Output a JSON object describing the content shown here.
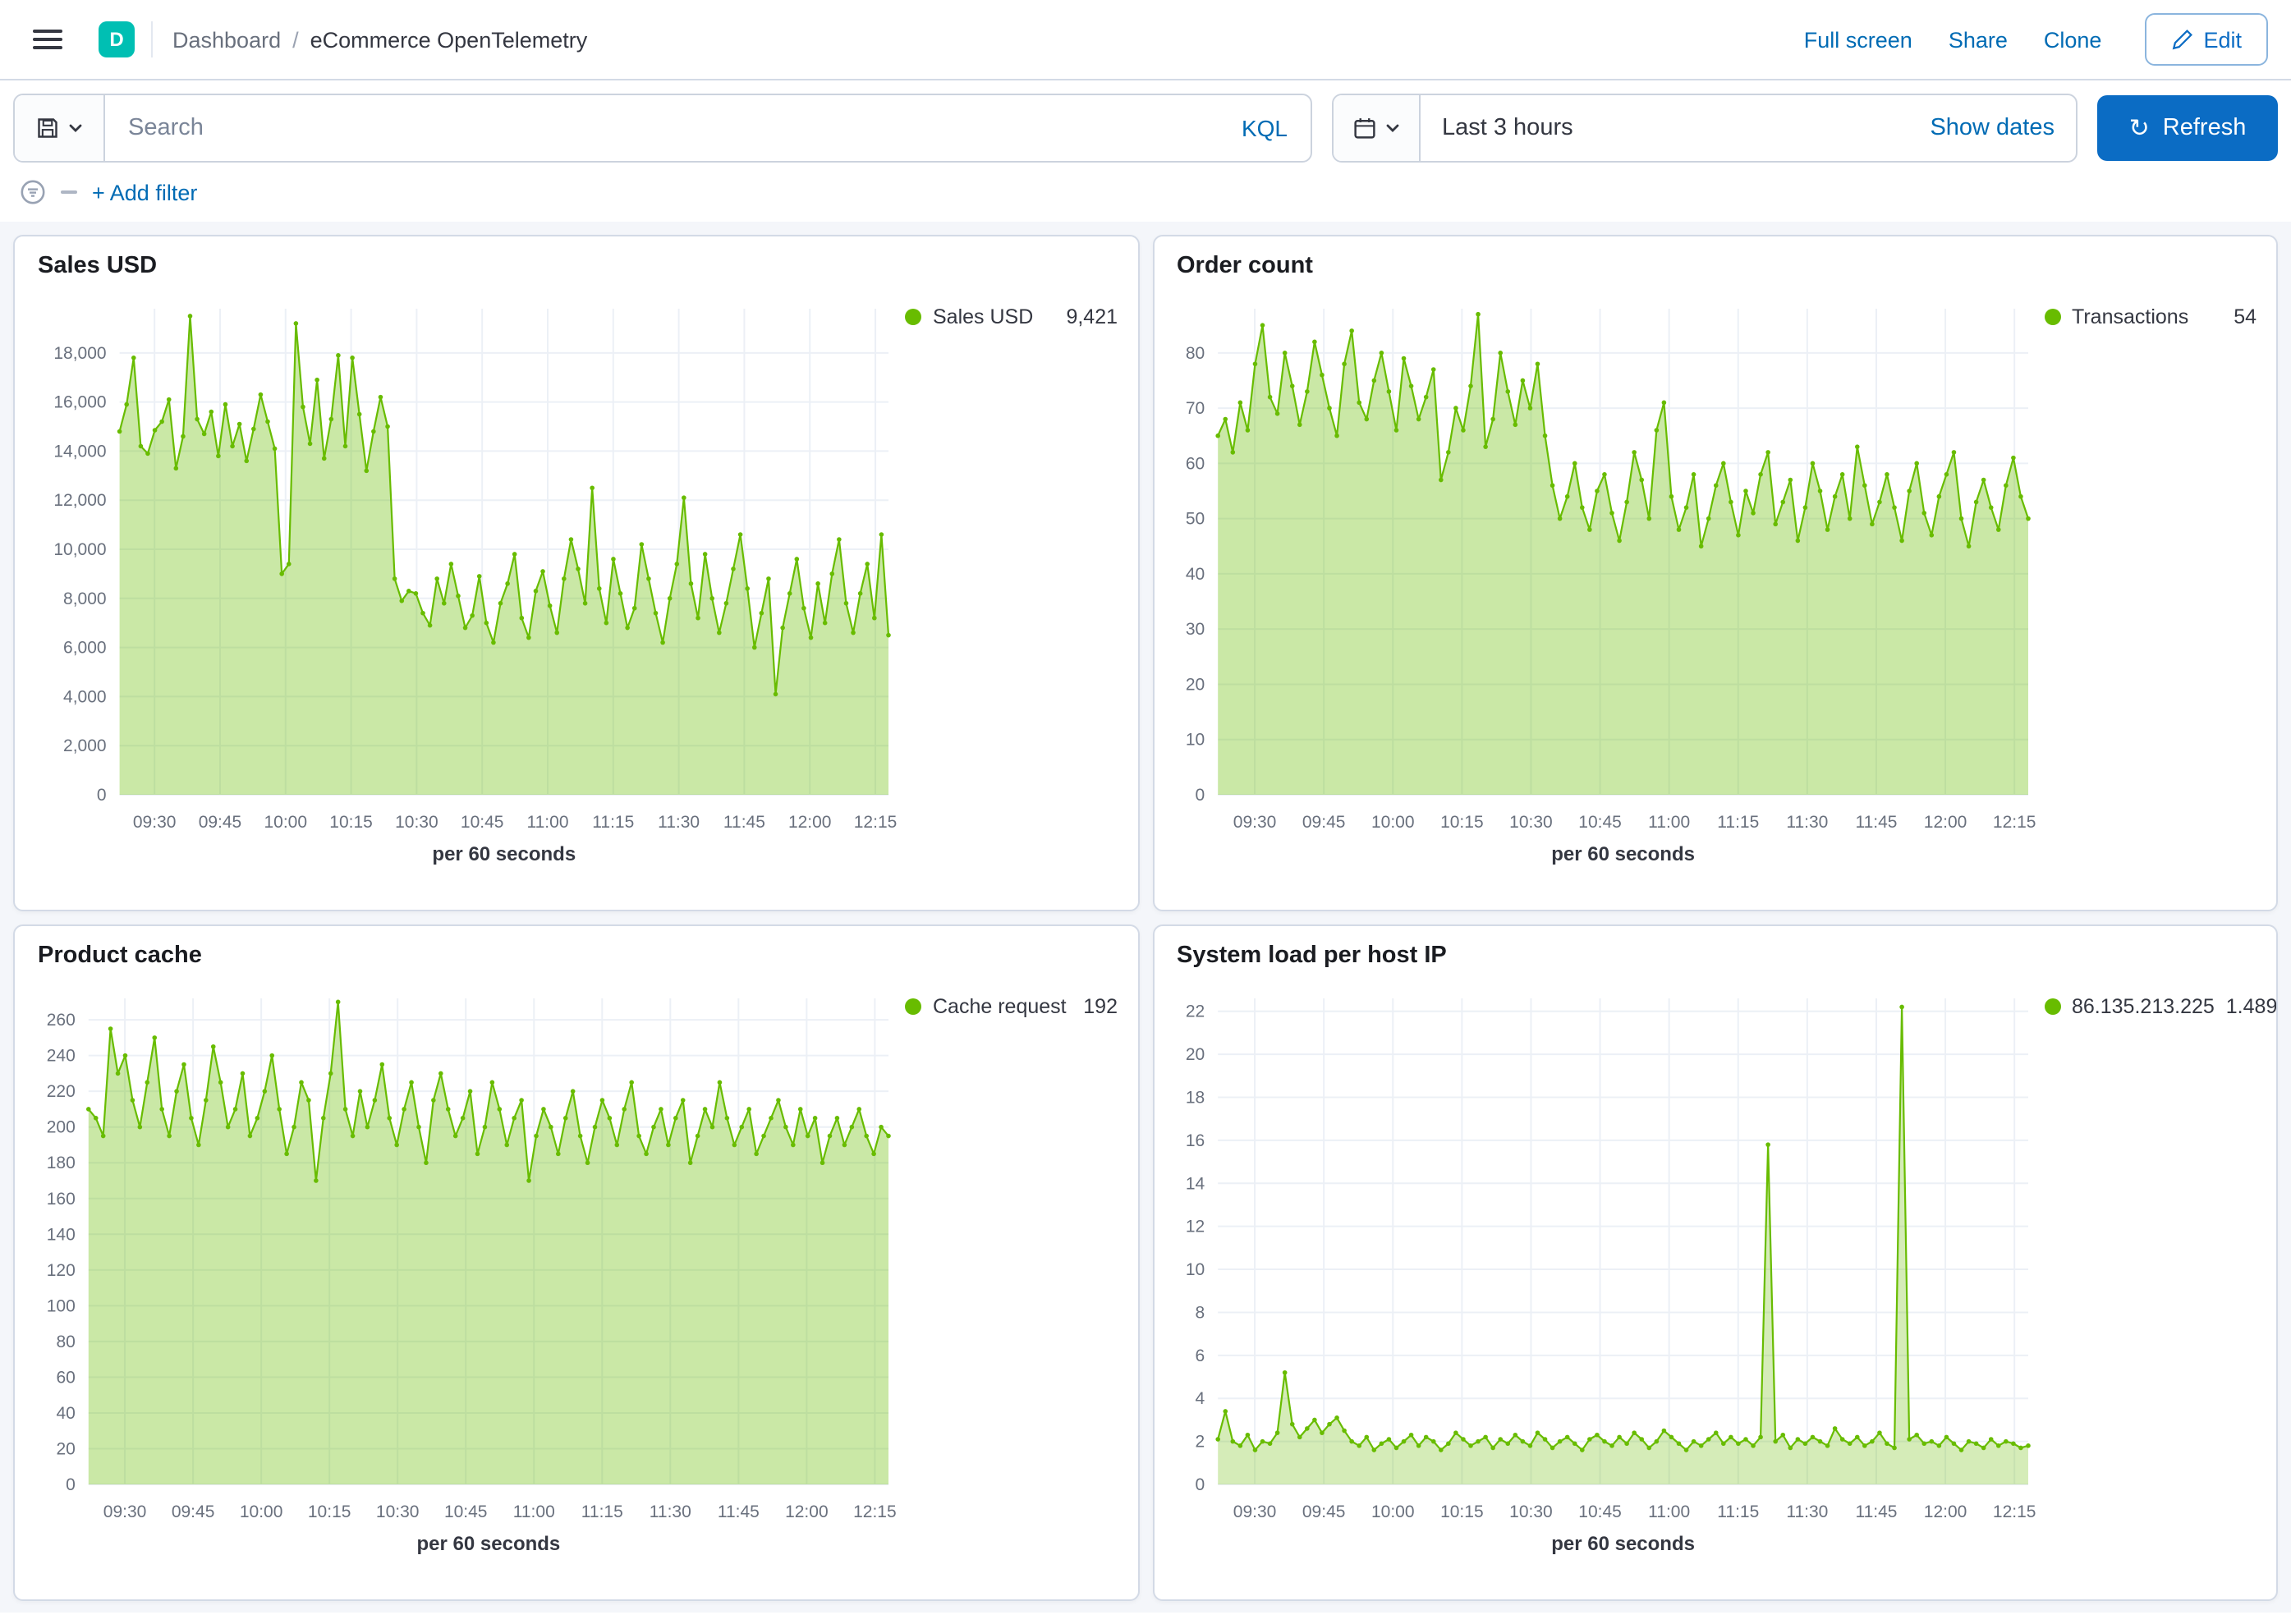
{
  "header": {
    "space_badge": "D",
    "breadcrumb": {
      "root": "Dashboard",
      "separator": "/",
      "current": "eCommerce OpenTelemetry"
    },
    "actions": [
      "Full screen",
      "Share",
      "Clone"
    ],
    "edit_label": "Edit"
  },
  "query_bar": {
    "search_placeholder": "Search",
    "kql_label": "KQL",
    "time_range": "Last 3 hours",
    "show_dates_label": "Show dates",
    "refresh_label": "Refresh"
  },
  "filter_bar": {
    "add_filter_label": "+ Add filter"
  },
  "colors": {
    "accent_green": "#68BC00",
    "grid": "#ecf0f6",
    "axis_text": "#69707d",
    "axis_title": "#343741",
    "primary_blue": "#0b6cc4",
    "link_blue": "#006bb4",
    "space_badge_teal": "#00bfb3"
  },
  "chart_data": [
    {
      "type": "area",
      "title": "Sales USD",
      "legend_label": "Sales USD",
      "legend_value": "9,421",
      "xlabel": "per 60 seconds",
      "x_domain": [
        "09:22",
        "12:18"
      ],
      "x_ticks": [
        "09:30",
        "09:45",
        "10:00",
        "10:15",
        "10:30",
        "10:45",
        "11:00",
        "11:15",
        "11:30",
        "11:45",
        "12:00",
        "12:15"
      ],
      "y_ticks": [
        0,
        2000,
        4000,
        6000,
        8000,
        10000,
        12000,
        14000,
        16000,
        18000
      ],
      "y_tick_labels": [
        "0",
        "2,000",
        "4,000",
        "6,000",
        "8,000",
        "10,000",
        "12,000",
        "14,000",
        "16,000",
        "18,000"
      ],
      "ylim": [
        0,
        19800
      ],
      "color": "#68BC00",
      "fill_opacity": 0.35,
      "values": [
        14800,
        15900,
        17800,
        14200,
        13900,
        14850,
        15200,
        16100,
        13300,
        14600,
        19500,
        15300,
        14700,
        15600,
        13800,
        15900,
        14200,
        15100,
        13600,
        14900,
        16300,
        15200,
        14100,
        9000,
        9400,
        19200,
        15800,
        14300,
        16900,
        13700,
        15300,
        17900,
        14200,
        17800,
        15500,
        13200,
        14800,
        16200,
        15000,
        8800,
        7900,
        8300,
        8200,
        7400,
        6900,
        8800,
        7800,
        9400,
        8100,
        6800,
        7300,
        8900,
        7000,
        6200,
        7800,
        8600,
        9800,
        7200,
        6400,
        8300,
        9100,
        7700,
        6600,
        8800,
        10400,
        9200,
        7800,
        12500,
        8400,
        7000,
        9600,
        8200,
        6800,
        7600,
        10200,
        8800,
        7400,
        6200,
        8000,
        9400,
        12100,
        8600,
        7200,
        9800,
        8000,
        6600,
        7800,
        9200,
        10600,
        8400,
        6000,
        7400,
        8800,
        4100,
        6800,
        8200,
        9600,
        7600,
        6400,
        8600,
        7000,
        9000,
        10400,
        7800,
        6600,
        8200,
        9400,
        7200,
        10600,
        6500
      ]
    },
    {
      "type": "area",
      "title": "Order count",
      "legend_label": "Transactions",
      "legend_value": "54",
      "xlabel": "per 60 seconds",
      "x_domain": [
        "09:22",
        "12:18"
      ],
      "x_ticks": [
        "09:30",
        "09:45",
        "10:00",
        "10:15",
        "10:30",
        "10:45",
        "11:00",
        "11:15",
        "11:30",
        "11:45",
        "12:00",
        "12:15"
      ],
      "y_ticks": [
        0,
        10,
        20,
        30,
        40,
        50,
        60,
        70,
        80
      ],
      "y_tick_labels": [
        "0",
        "10",
        "20",
        "30",
        "40",
        "50",
        "60",
        "70",
        "80"
      ],
      "ylim": [
        0,
        88
      ],
      "color": "#68BC00",
      "fill_opacity": 0.35,
      "values": [
        65,
        68,
        62,
        71,
        66,
        78,
        85,
        72,
        69,
        80,
        74,
        67,
        73,
        82,
        76,
        70,
        65,
        78,
        84,
        71,
        68,
        75,
        80,
        73,
        66,
        79,
        74,
        68,
        72,
        77,
        57,
        62,
        70,
        66,
        74,
        87,
        63,
        68,
        80,
        73,
        67,
        75,
        70,
        78,
        65,
        56,
        50,
        54,
        60,
        52,
        48,
        55,
        58,
        51,
        46,
        53,
        62,
        57,
        50,
        66,
        71,
        54,
        48,
        52,
        58,
        45,
        50,
        56,
        60,
        53,
        47,
        55,
        51,
        58,
        62,
        49,
        53,
        57,
        46,
        52,
        60,
        55,
        48,
        54,
        58,
        50,
        63,
        56,
        49,
        53,
        58,
        52,
        46,
        55,
        60,
        51,
        47,
        54,
        58,
        62,
        50,
        45,
        53,
        57,
        52,
        48,
        56,
        61,
        54,
        50
      ]
    },
    {
      "type": "area",
      "title": "Product cache",
      "legend_label": "Cache request",
      "legend_value": "192",
      "xlabel": "per 60 seconds",
      "x_domain": [
        "09:22",
        "12:18"
      ],
      "x_ticks": [
        "09:30",
        "09:45",
        "10:00",
        "10:15",
        "10:30",
        "10:45",
        "11:00",
        "11:15",
        "11:30",
        "11:45",
        "12:00",
        "12:15"
      ],
      "y_ticks": [
        0,
        20,
        40,
        60,
        80,
        100,
        120,
        140,
        160,
        180,
        200,
        220,
        240,
        260
      ],
      "y_tick_labels": [
        "0",
        "20",
        "40",
        "60",
        "80",
        "100",
        "120",
        "140",
        "160",
        "180",
        "200",
        "220",
        "240",
        "260"
      ],
      "ylim": [
        0,
        272
      ],
      "color": "#68BC00",
      "fill_opacity": 0.35,
      "values": [
        210,
        205,
        195,
        255,
        230,
        240,
        215,
        200,
        225,
        250,
        210,
        195,
        220,
        235,
        205,
        190,
        215,
        245,
        225,
        200,
        210,
        230,
        195,
        205,
        220,
        240,
        210,
        185,
        200,
        225,
        215,
        170,
        205,
        230,
        270,
        210,
        195,
        220,
        200,
        215,
        235,
        205,
        190,
        210,
        225,
        200,
        180,
        215,
        230,
        210,
        195,
        205,
        220,
        185,
        200,
        225,
        210,
        190,
        205,
        215,
        170,
        195,
        210,
        200,
        185,
        205,
        220,
        195,
        180,
        200,
        215,
        205,
        190,
        210,
        225,
        195,
        185,
        200,
        210,
        190,
        205,
        215,
        180,
        195,
        210,
        200,
        225,
        205,
        190,
        200,
        210,
        185,
        195,
        205,
        215,
        200,
        190,
        210,
        195,
        205,
        180,
        195,
        205,
        190,
        200,
        210,
        195,
        185,
        200,
        195
      ]
    },
    {
      "type": "area",
      "title": "System load per host IP",
      "legend_label": "86.135.213.225",
      "legend_value": "1.489",
      "xlabel": "per 60 seconds",
      "x_domain": [
        "09:22",
        "12:18"
      ],
      "x_ticks": [
        "09:30",
        "09:45",
        "10:00",
        "10:15",
        "10:30",
        "10:45",
        "11:00",
        "11:15",
        "11:30",
        "11:45",
        "12:00",
        "12:15"
      ],
      "y_ticks": [
        0,
        2,
        4,
        6,
        8,
        10,
        12,
        14,
        16,
        18,
        20,
        22
      ],
      "y_tick_labels": [
        "0",
        "2",
        "4",
        "6",
        "8",
        "10",
        "12",
        "14",
        "16",
        "18",
        "20",
        "22"
      ],
      "ylim": [
        0,
        22.6
      ],
      "color": "#68BC00",
      "fill_opacity": 0.28,
      "values": [
        2.1,
        3.4,
        2.0,
        1.8,
        2.3,
        1.6,
        2.0,
        1.9,
        2.4,
        5.2,
        2.8,
        2.2,
        2.6,
        3.0,
        2.4,
        2.8,
        3.1,
        2.5,
        2.0,
        1.8,
        2.2,
        1.6,
        1.9,
        2.1,
        1.7,
        2.0,
        2.3,
        1.8,
        2.2,
        2.0,
        1.6,
        1.9,
        2.4,
        2.1,
        1.8,
        2.0,
        2.2,
        1.7,
        2.1,
        1.9,
        2.3,
        2.0,
        1.8,
        2.4,
        2.1,
        1.7,
        2.0,
        2.2,
        1.9,
        1.6,
        2.1,
        2.3,
        2.0,
        1.8,
        2.2,
        1.9,
        2.4,
        2.1,
        1.7,
        2.0,
        2.5,
        2.2,
        1.9,
        1.6,
        2.0,
        1.8,
        2.1,
        2.4,
        1.9,
        2.2,
        1.9,
        2.1,
        1.8,
        2.2,
        15.8,
        2.0,
        2.3,
        1.7,
        2.1,
        1.9,
        2.2,
        2.0,
        1.8,
        2.6,
        2.1,
        1.9,
        2.2,
        1.8,
        2.0,
        2.4,
        1.9,
        1.7,
        22.2,
        2.1,
        2.3,
        1.9,
        2.0,
        1.8,
        2.2,
        1.9,
        1.6,
        2.0,
        1.9,
        1.7,
        2.1,
        1.8,
        2.0,
        1.9,
        1.7,
        1.8
      ]
    }
  ]
}
